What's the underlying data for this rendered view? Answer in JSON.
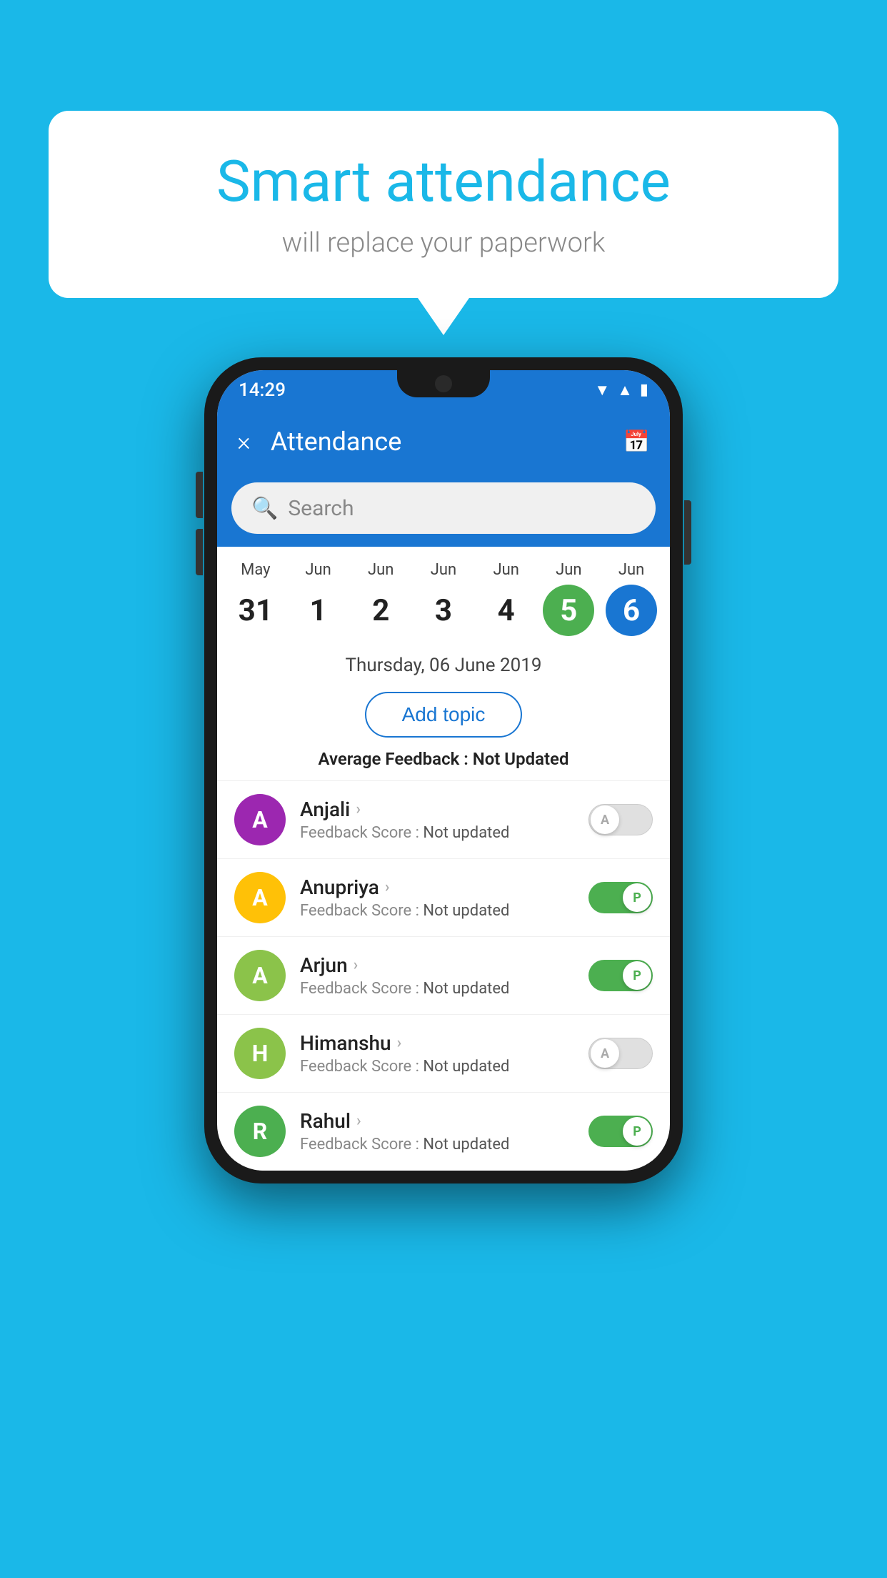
{
  "background_color": "#1ab8e8",
  "bubble": {
    "title": "Smart attendance",
    "subtitle": "will replace your paperwork"
  },
  "status_bar": {
    "time": "14:29",
    "icons": [
      "wifi",
      "signal",
      "battery"
    ]
  },
  "app_bar": {
    "title": "Attendance",
    "close_label": "×",
    "calendar_icon": "📅"
  },
  "search": {
    "placeholder": "Search"
  },
  "calendar": {
    "days": [
      {
        "month": "May",
        "num": "31",
        "state": "normal"
      },
      {
        "month": "Jun",
        "num": "1",
        "state": "normal"
      },
      {
        "month": "Jun",
        "num": "2",
        "state": "normal"
      },
      {
        "month": "Jun",
        "num": "3",
        "state": "normal"
      },
      {
        "month": "Jun",
        "num": "4",
        "state": "normal"
      },
      {
        "month": "Jun",
        "num": "5",
        "state": "today"
      },
      {
        "month": "Jun",
        "num": "6",
        "state": "selected"
      }
    ]
  },
  "selected_date": "Thursday, 06 June 2019",
  "add_topic_label": "Add topic",
  "avg_feedback_label": "Average Feedback :",
  "avg_feedback_value": "Not Updated",
  "students": [
    {
      "name": "Anjali",
      "avatar_letter": "A",
      "avatar_color": "#9c27b0",
      "feedback_label": "Feedback Score :",
      "feedback_value": "Not updated",
      "toggle_state": "off",
      "toggle_label": "A"
    },
    {
      "name": "Anupriya",
      "avatar_letter": "A",
      "avatar_color": "#ffc107",
      "feedback_label": "Feedback Score :",
      "feedback_value": "Not updated",
      "toggle_state": "on",
      "toggle_label": "P"
    },
    {
      "name": "Arjun",
      "avatar_letter": "A",
      "avatar_color": "#8bc34a",
      "feedback_label": "Feedback Score :",
      "feedback_value": "Not updated",
      "toggle_state": "on",
      "toggle_label": "P"
    },
    {
      "name": "Himanshu",
      "avatar_letter": "H",
      "avatar_color": "#8bc34a",
      "feedback_label": "Feedback Score :",
      "feedback_value": "Not updated",
      "toggle_state": "off",
      "toggle_label": "A"
    },
    {
      "name": "Rahul",
      "avatar_letter": "R",
      "avatar_color": "#4caf50",
      "feedback_label": "Feedback Score :",
      "feedback_value": "Not updated",
      "toggle_state": "on",
      "toggle_label": "P"
    }
  ]
}
